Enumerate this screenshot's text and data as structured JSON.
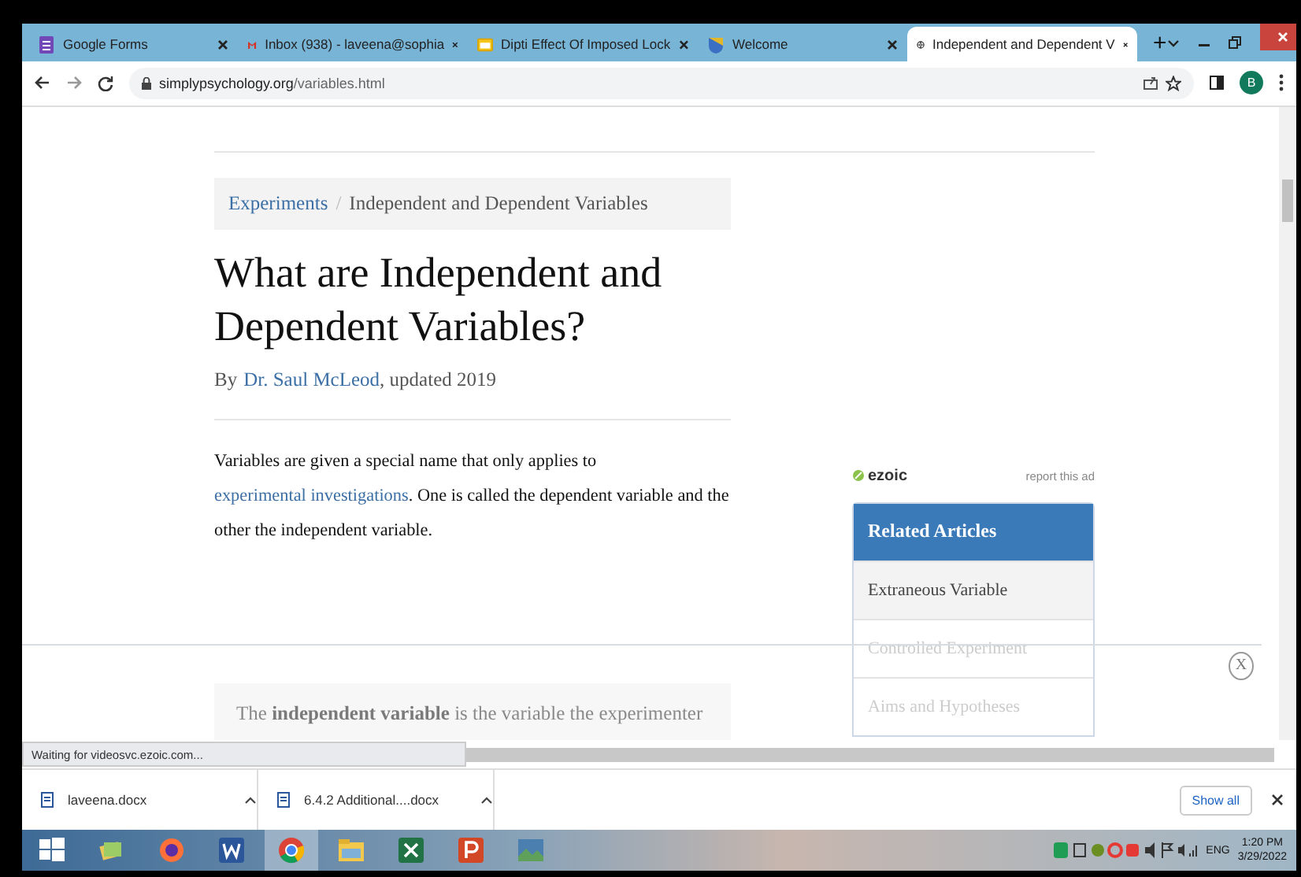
{
  "browser": {
    "tabs": [
      {
        "title": "Google Forms",
        "selected": false
      },
      {
        "title": "Inbox (938) - laveena@sophia",
        "selected": false
      },
      {
        "title": "Dipti Effect Of Imposed Lock",
        "selected": false
      },
      {
        "title": "Welcome",
        "selected": false
      },
      {
        "title": "Independent and Dependent V",
        "selected": true
      }
    ],
    "new_tab": "+",
    "address": {
      "domain": "simplypsychology.org",
      "path": "/variables.html"
    },
    "profile_initial": "B"
  },
  "page": {
    "breadcrumb": {
      "link": "Experiments",
      "separator": "/",
      "current": "Independent and Dependent Variables"
    },
    "title": "What are Independent and Dependent Variables?",
    "byline": {
      "prefix": "By",
      "author": "Dr. Saul McLeod",
      "suffix": ", updated 2019"
    },
    "intro": {
      "before": "Variables are given a special name that only applies to ",
      "link": "experimental investigations",
      "after": ". One is called the dependent variable and the other the independent variable."
    },
    "ad": {
      "brand": "ezoic",
      "report": "report this ad"
    },
    "related": {
      "heading": "Related Articles",
      "items": [
        {
          "label": "Extraneous Variable",
          "selected": true
        },
        {
          "label": "Controlled Experiment",
          "selected": false
        },
        {
          "label": "Aims and Hypotheses",
          "selected": false
        }
      ]
    },
    "callout": "The **independent variable** is the variable the experimenter",
    "close_label": "X"
  },
  "status": "Waiting for videosvc.ezoic.com...",
  "downloads": {
    "files": [
      "laveena.docx",
      "6.4.2 Additional....docx"
    ],
    "show_all": "Show all"
  },
  "taskbar": {
    "apps": [
      {
        "kind": "folders",
        "selected": false
      },
      {
        "kind": "firefox",
        "selected": false
      },
      {
        "kind": "word",
        "selected": false
      },
      {
        "kind": "chrome",
        "selected": true
      },
      {
        "kind": "explorer",
        "selected": false
      },
      {
        "kind": "excel",
        "selected": false
      },
      {
        "kind": "powerpoint",
        "selected": false
      },
      {
        "kind": "photos",
        "selected": false
      }
    ],
    "language": "ENG",
    "time": "1:20 PM",
    "date": "3/29/2022"
  }
}
